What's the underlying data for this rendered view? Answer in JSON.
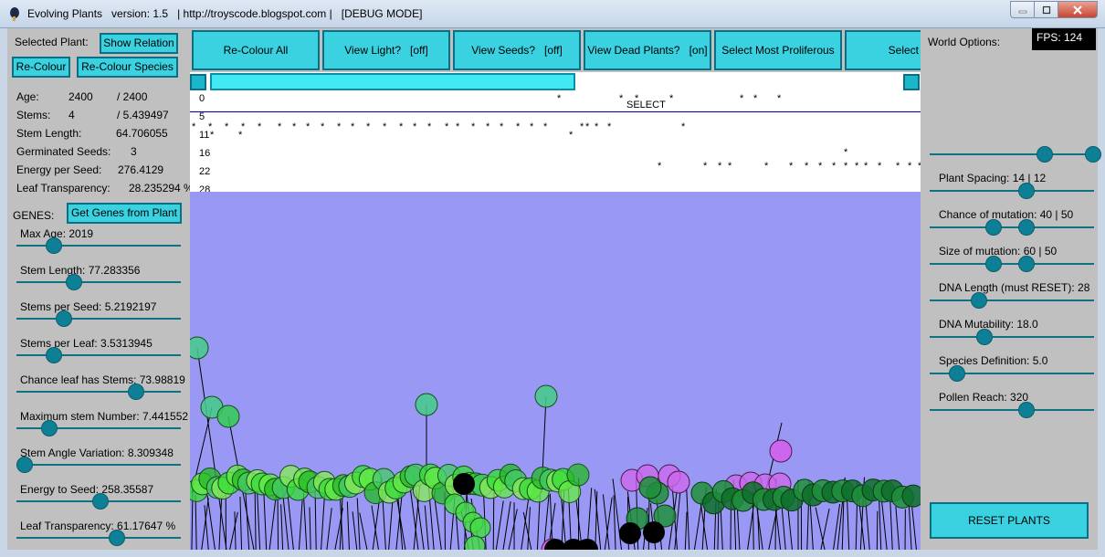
{
  "window": {
    "title": "Evolving Plants   version: 1.5   | http://troyscode.blogspot.com |   [DEBUG MODE]"
  },
  "left_panel": {
    "selected_plant_label": "Selected Plant:",
    "show_relation": "Show Relation",
    "recolour": "Re-Colour",
    "recolour_species": "Re-Colour Species",
    "stats": [
      {
        "label": "Age:",
        "value": "2400",
        "max": "/ 2400"
      },
      {
        "label": "Stems:",
        "value": "4",
        "max": "/ 5.439497"
      },
      {
        "label": "Stem Length:",
        "value": "64.706055",
        "max": ""
      },
      {
        "label": "Germinated Seeds:",
        "value": "3",
        "max": ""
      },
      {
        "label": "Energy per Seed:",
        "value": "276.4129",
        "max": ""
      },
      {
        "label": "Leaf Transparency:",
        "value": "28.235294 %",
        "max": ""
      }
    ],
    "genes_label": "GENES:",
    "get_genes": "Get Genes from Plant",
    "genes": [
      {
        "label": "Max Age: 2019",
        "level": 0.23
      },
      {
        "label": "Stem Length: 77.283356",
        "level": 0.35
      },
      {
        "label": "Stems per Seed: 5.2192197",
        "level": 0.29
      },
      {
        "label": "Stems per Leaf: 3.5313945",
        "level": 0.23
      },
      {
        "label": "Chance leaf has Stems: 73.98819",
        "level": 0.73
      },
      {
        "label": "Maximum stem Number: 7.441552",
        "level": 0.2
      },
      {
        "label": "Stem Angle Variation: 8.309348",
        "level": 0.05
      },
      {
        "label": "Energy to Seed: 258.35587",
        "level": 0.51
      },
      {
        "label": "Leaf Transparency: 61.17647 %",
        "level": 0.61
      }
    ]
  },
  "toolbar": {
    "buttons": [
      {
        "name": "recolour-all",
        "label": "Re-Colour All",
        "state": ""
      },
      {
        "name": "view-light",
        "label": "View Light?",
        "state": "[off]"
      },
      {
        "name": "view-seeds",
        "label": "View Seeds?",
        "state": "[off]"
      },
      {
        "name": "view-dead-plants",
        "label": "View Dead Plants?",
        "state": "[on]"
      },
      {
        "name": "select-most-proliferous",
        "label": "Select Most Proliferous",
        "state": ""
      },
      {
        "name": "select-p",
        "label": "Select P",
        "state": ""
      }
    ]
  },
  "species_list": {
    "select_label": "SELECT",
    "line_numbers": [
      "0",
      "5",
      "11",
      "16",
      "22",
      "28"
    ],
    "star": "*"
  },
  "right_panel": {
    "world_options": "World Options:",
    "fps": "FPS: 124",
    "settings": [
      {
        "label": "Plant Spacing: 14 | 12"
      },
      {
        "label": "Chance of mutation: 40 | 50"
      },
      {
        "label": "Size of mutation: 60 | 50"
      },
      {
        "label": "DNA Length (must RESET): 28"
      },
      {
        "label": "DNA Mutability: 18.0"
      },
      {
        "label": "Species Definition: 5.0"
      },
      {
        "label": "Pollen Reach: 320"
      }
    ],
    "reset": "RESET PLANTS"
  },
  "colors": {
    "button": "#3ad1e0",
    "button_border": "#0b6f85",
    "knob": "#0e8096",
    "world_bg": "#9999f5",
    "panel_bg": "#c0c0c0"
  }
}
